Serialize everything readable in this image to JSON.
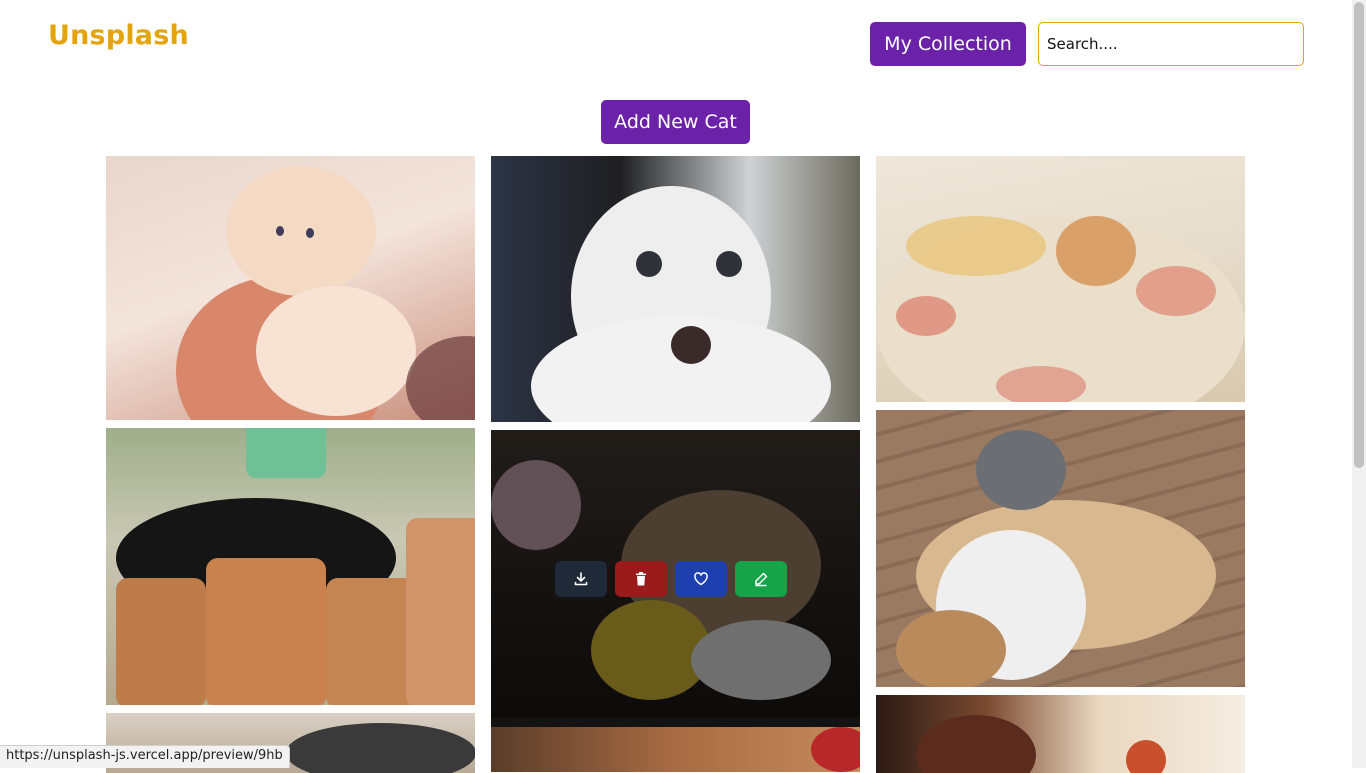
{
  "app": {
    "brand": "Unsplash",
    "brand_color": "#e5a50a",
    "accent_color": "#6b21a8"
  },
  "header": {
    "collection_label": "My Collection",
    "search_placeholder": "Search...."
  },
  "main": {
    "add_button_label": "Add New Cat",
    "gallery": [
      {
        "subject": "orange kitten held in hands"
      },
      {
        "subject": "surprised white and grey cat"
      },
      {
        "subject": "kitten under patterned blanket"
      },
      {
        "subject": "black and white cat sleeping in flower pots"
      },
      {
        "subject": "cat in basket with toy (hovered)"
      },
      {
        "subject": "cats resting on a dog"
      },
      {
        "subject": "cat on cardboard"
      },
      {
        "subject": "cat on wooden floor"
      },
      {
        "subject": "cat on bed with toy"
      }
    ],
    "hover_actions": [
      {
        "name": "download",
        "icon": "download-icon",
        "color": "#1f2937"
      },
      {
        "name": "delete",
        "icon": "trash-icon",
        "color": "#991b1b"
      },
      {
        "name": "like",
        "icon": "heart-icon",
        "color": "#1e40af"
      },
      {
        "name": "edit",
        "icon": "pencil-icon",
        "color": "#16a34a"
      }
    ]
  },
  "status_bar": {
    "link_url": "https://unsplash-js.vercel.app/preview/9hb"
  }
}
